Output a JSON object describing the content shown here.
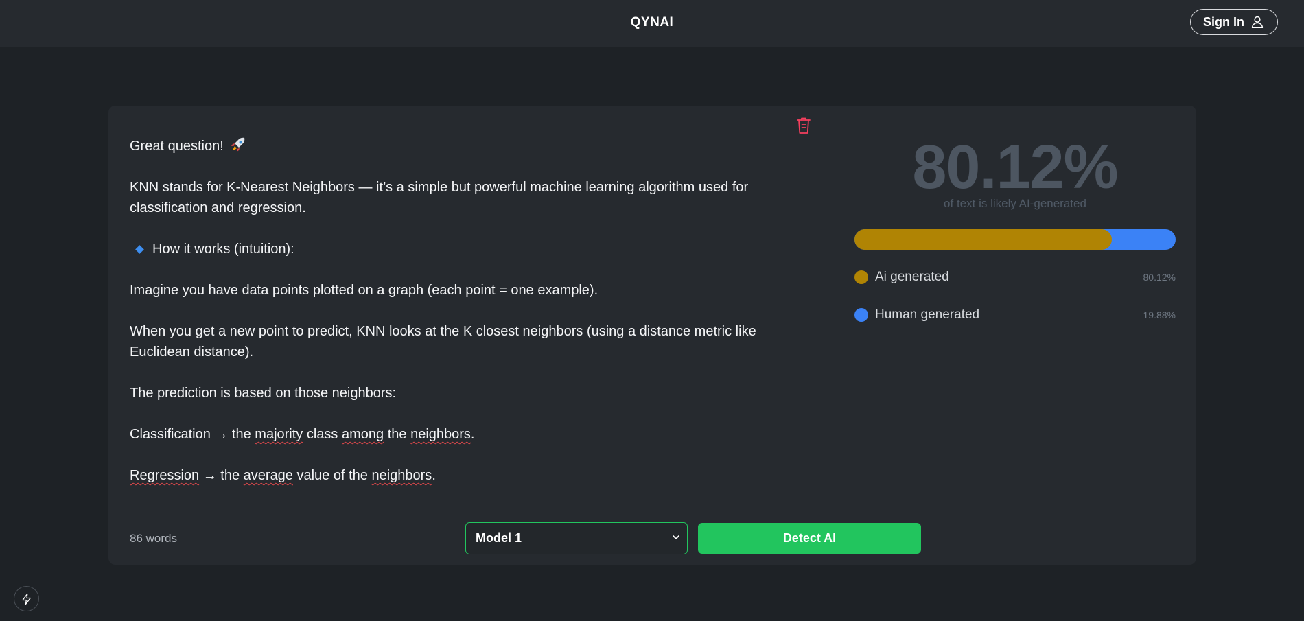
{
  "header": {
    "brand": "QYNAI",
    "signin_label": "Sign In"
  },
  "editor": {
    "paragraphs": {
      "p1": "Great question!",
      "p2": "KNN stands for K-Nearest Neighbors — it’s a simple but powerful machine learning algorithm used for classification and regression.",
      "p3": "How it works (intuition):",
      "p4": "Imagine you have data points plotted on a graph (each point = one example).",
      "p5": "When you get a new point to predict, KNN looks at the K closest neighbors (using a distance metric like Euclidean distance).",
      "p6": "The prediction is based on those neighbors:",
      "p7a": "Classification → the ",
      "p7b": "majority",
      "p7c": " class ",
      "p7d": "among",
      "p7e": " the ",
      "p7f": "neighbors",
      "p7g": ".",
      "p8a": "Regression",
      "p8b": " → the ",
      "p8c": "average",
      "p8d": " value of the ",
      "p8e": "neighbors",
      "p8f": "."
    },
    "word_count": "86 words",
    "model_select": "Model 1",
    "detect_label": "Detect AI"
  },
  "result": {
    "percent": "80.12%",
    "subtitle": "of text is likely AI-generated",
    "ai_fraction": 0.8012,
    "legend": {
      "ai_label": "Ai generated",
      "ai_value": "80.12%",
      "human_label": "Human generated",
      "human_value": "19.88%"
    },
    "colors": {
      "ai": "#b08404",
      "human": "#3b82f6",
      "accent": "#22c55e"
    }
  },
  "icons": {
    "trash": "trash-icon",
    "user": "user-icon",
    "rocket": "rocket-emoji",
    "bullet": "blue-diamond-icon",
    "bolt": "bolt-icon"
  }
}
